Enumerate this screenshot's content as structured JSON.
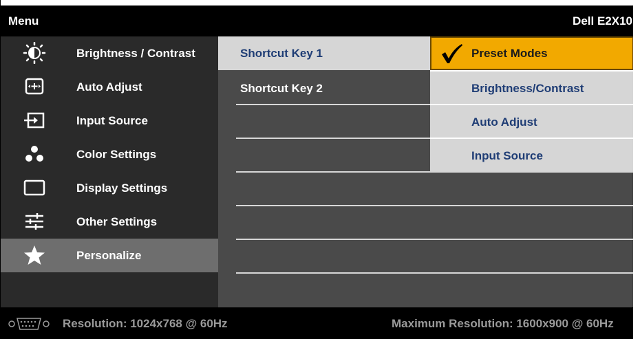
{
  "header": {
    "menu_title": "Menu",
    "model": "Dell E2X10"
  },
  "left_menu": {
    "items": [
      {
        "label": "Brightness / Contrast",
        "icon": "brightness-icon",
        "active": false
      },
      {
        "label": "Auto Adjust",
        "icon": "auto-adjust-icon",
        "active": false
      },
      {
        "label": "Input Source",
        "icon": "input-source-icon",
        "active": false
      },
      {
        "label": "Color Settings",
        "icon": "color-settings-icon",
        "active": false
      },
      {
        "label": "Display Settings",
        "icon": "display-settings-icon",
        "active": false
      },
      {
        "label": "Other Settings",
        "icon": "other-settings-icon",
        "active": false
      },
      {
        "label": "Personalize",
        "icon": "star-icon",
        "active": true
      }
    ]
  },
  "middle_menu": {
    "items": [
      {
        "label": "Shortcut Key 1",
        "selected": true
      },
      {
        "label": "Shortcut Key 2",
        "selected": false
      }
    ]
  },
  "right_menu": {
    "items": [
      {
        "label": "Preset Modes",
        "checked": true
      },
      {
        "label": "Brightness/Contrast",
        "checked": false
      },
      {
        "label": "Auto Adjust",
        "checked": false
      },
      {
        "label": "Input Source",
        "checked": false
      }
    ]
  },
  "status": {
    "resolution": "Resolution: 1024x768 @ 60Hz",
    "max_resolution": "Maximum Resolution: 1600x900 @ 60Hz",
    "connector_icon": "vga-connector-icon"
  },
  "colors": {
    "highlight": "#f2a900",
    "selected_bg": "#d6d6d6",
    "selected_text": "#1f3d75",
    "active_item_bg": "#6e6e6e"
  }
}
